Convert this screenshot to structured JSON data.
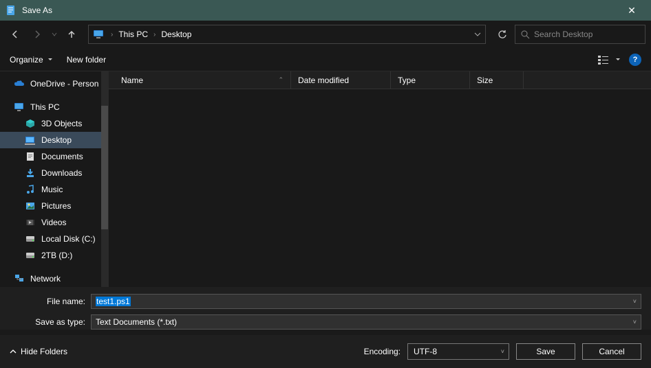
{
  "title": "Save As",
  "breadcrumb": {
    "root": "This PC",
    "current": "Desktop"
  },
  "search": {
    "placeholder": "Search Desktop"
  },
  "toolbar": {
    "organize": "Organize",
    "newfolder": "New folder"
  },
  "sidebar": {
    "onedrive": "OneDrive - Person",
    "thispc": "This PC",
    "objects3d": "3D Objects",
    "desktop": "Desktop",
    "documents": "Documents",
    "downloads": "Downloads",
    "music": "Music",
    "pictures": "Pictures",
    "videos": "Videos",
    "localdisk": "Local Disk (C:)",
    "tb2": "2TB (D:)",
    "network": "Network"
  },
  "columns": {
    "name": "Name",
    "date": "Date modified",
    "type": "Type",
    "size": "Size"
  },
  "form": {
    "filename_label": "File name:",
    "filename_value": "test1.ps1",
    "type_label": "Save as type:",
    "type_value": "Text Documents (*.txt)"
  },
  "footer": {
    "hide_folders": "Hide Folders",
    "encoding_label": "Encoding:",
    "encoding_value": "UTF-8",
    "save": "Save",
    "cancel": "Cancel"
  }
}
